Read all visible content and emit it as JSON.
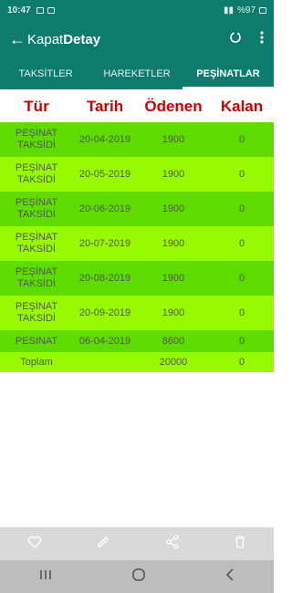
{
  "status": {
    "time": "10:47",
    "battery": "%97"
  },
  "app_bar": {
    "back_icon": "back-arrow-icon",
    "title_a": "Kapat",
    "title_b": "Detay"
  },
  "tabs": [
    {
      "label": "TAKSİTLER"
    },
    {
      "label": "HAREKETLER"
    },
    {
      "label": "PEŞİNATLAR"
    }
  ],
  "table": {
    "headers": [
      "Tür",
      "Tarih",
      "Ödenen",
      "Kalan"
    ],
    "rows": [
      {
        "tur1": "PEŞİNAT",
        "tur2": "TAKSİDİ",
        "tarih": "20-04-2019",
        "odenen": "1900",
        "kalan": "0"
      },
      {
        "tur1": "PEŞİNAT",
        "tur2": "TAKSİDİ",
        "tarih": "20-05-2019",
        "odenen": "1900",
        "kalan": "0"
      },
      {
        "tur1": "PEŞİNAT",
        "tur2": "TAKSİDİ",
        "tarih": "20-06-2019",
        "odenen": "1900",
        "kalan": "0"
      },
      {
        "tur1": "PEŞİNAT",
        "tur2": "TAKSİDİ",
        "tarih": "20-07-2019",
        "odenen": "1900",
        "kalan": "0"
      },
      {
        "tur1": "PEŞİNAT",
        "tur2": "TAKSİDİ",
        "tarih": "20-08-2019",
        "odenen": "1900",
        "kalan": "0"
      },
      {
        "tur1": "PEŞİNAT",
        "tur2": "TAKSİDİ",
        "tarih": "20-09-2019",
        "odenen": "1900",
        "kalan": "0"
      }
    ],
    "single": {
      "tur": "PESINAT",
      "tarih": "06-04-2019",
      "odenen": "8600",
      "kalan": "0"
    },
    "total": {
      "label": "Toplam",
      "odenen": "20000",
      "kalan": "0"
    }
  },
  "colors": {
    "primary": "#0d7b6e",
    "row_dark": "#5edc00",
    "row_light": "#98fa00",
    "header_text": "#d00000"
  }
}
